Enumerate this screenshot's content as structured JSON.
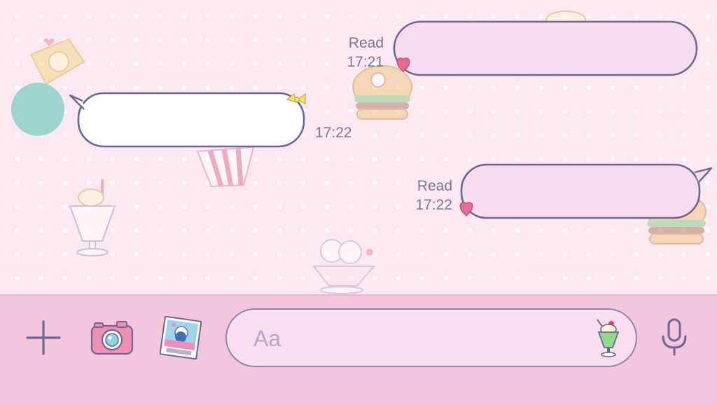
{
  "theme": {
    "chat_background": "#fbe8f1",
    "input_bar_background": "#f3c6dd",
    "outgoing_bubble_fill": "#f9dcef",
    "incoming_bubble_fill": "#ffffff",
    "bubble_outline": "#6c6692",
    "avatar_color": "#9ed4ce"
  },
  "messages": [
    {
      "direction": "outgoing",
      "text": "",
      "read_label": "Read",
      "time": "17:21"
    },
    {
      "direction": "incoming",
      "text": "",
      "time": "17:22"
    },
    {
      "direction": "outgoing",
      "text": "",
      "read_label": "Read",
      "time": "17:22"
    }
  ],
  "input_bar": {
    "placeholder": "Aa",
    "add_icon": "plus-icon",
    "camera_icon": "camera-icon",
    "photo_icon": "photo-icon",
    "sticker_icon": "cream-soda-icon",
    "mic_icon": "microphone-icon"
  }
}
